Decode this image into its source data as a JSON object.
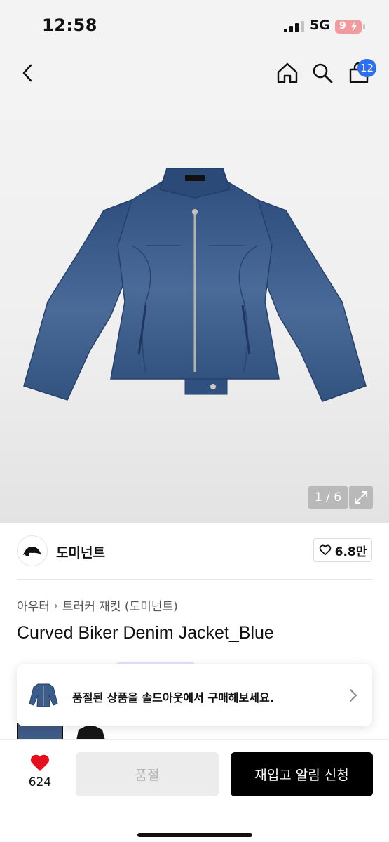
{
  "status_bar": {
    "time": "12:58",
    "network": "5G",
    "battery": "9"
  },
  "nav": {
    "cart_count": "12"
  },
  "product_image": {
    "pager": "1 / 6"
  },
  "brand": {
    "name": "도미넌트",
    "likes": "6.8만"
  },
  "breadcrumb": {
    "category": "아우터",
    "subcategory": "트러커 재킷 (도미넌트)"
  },
  "product": {
    "title": "Curved Biker Denim Jacket_Blue"
  },
  "soldout_banner": {
    "text": "품절된 상품을 솔드아웃에서 구매해보세요."
  },
  "bottom_bar": {
    "wish_count": "624",
    "soldout_label": "품절",
    "restock_label": "재입고 알림 신청"
  },
  "colors": {
    "accent_blue": "#2d6ff2",
    "wish_red": "#e5101e",
    "denim": "#3b5d8c"
  },
  "icons": [
    "signal-icon",
    "battery-icon",
    "back-arrow-icon",
    "home-icon",
    "search-icon",
    "cart-icon",
    "expand-icon",
    "heart-outline-icon",
    "chevron-right-icon",
    "heart-filled-icon"
  ]
}
